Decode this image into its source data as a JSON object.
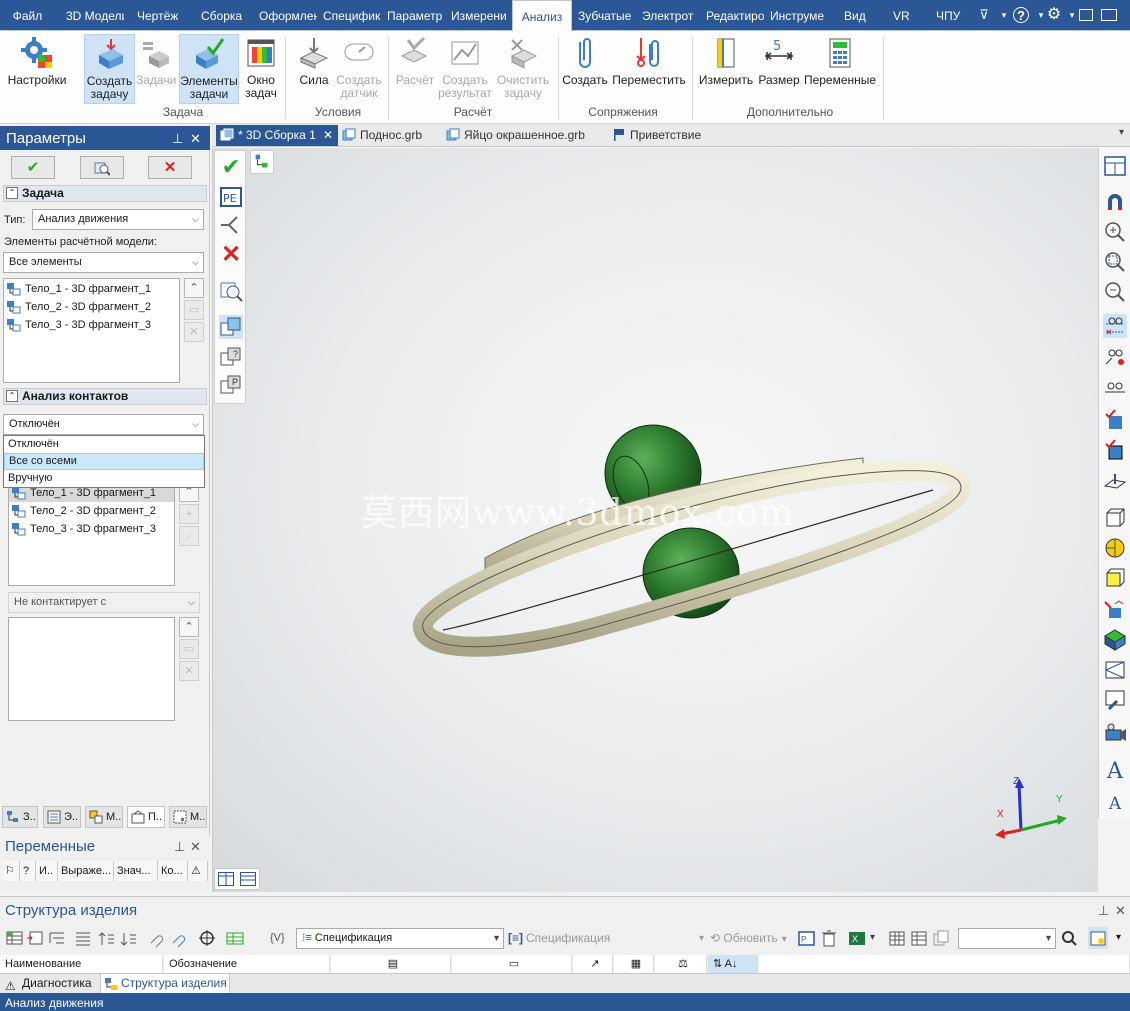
{
  "menu": {
    "tabs": [
      "Файл",
      "3D Модели",
      "Чертёж",
      "Сборка",
      "Оформлен",
      "Специфик",
      "Параметр",
      "Измерени",
      "Анализ",
      "Зубчатые",
      "Электрот",
      "Редактиро",
      "Инструме",
      "Вид",
      "VR",
      "ЧПУ"
    ],
    "active": "Анализ"
  },
  "ribbon": {
    "buttons": {
      "settings": "Настройки",
      "create_task": "Создать задачу",
      "tasks": "Задачи",
      "elements": "Элементы задачи",
      "window": "Окно задач",
      "force": "Сила",
      "create_sensor": "Создать датчик",
      "calc": "Расчёт",
      "create_result": "Создать результат",
      "clear_task": "Очистить задачу",
      "create": "Создать",
      "move": "Переместить",
      "measure": "Измерить",
      "size": "Размер",
      "variables": "Переменные"
    },
    "groups": {
      "task": "Задача",
      "conditions": "Условия",
      "calc": "Расчёт",
      "mates": "Сопряжения",
      "extra": "Дополнительно"
    }
  },
  "params": {
    "title": "Параметры",
    "task_section": "Задача",
    "type_label": "Тип:",
    "type_value": "Анализ движения",
    "elements_label": "Элементы расчётной модели:",
    "elements_value": "Все элементы",
    "bodies": [
      "Тело_1 - 3D фрагмент_1",
      "Тело_2 - 3D фрагмент_2",
      "Тело_3 - 3D фрагмент_3"
    ],
    "contacts_section": "Анализ контактов",
    "contacts_value": "Отключён",
    "contacts_options": [
      "Отключён",
      "Все со всеми",
      "Вручную"
    ],
    "contacts_highlight": "Все со всеми",
    "contact_bodies": [
      "Тело_1 - 3D фрагмент_1",
      "Тело_2 - 3D фрагмент_2",
      "Тело_3 - 3D фрагмент_3"
    ],
    "no_contact": "Не контактирует с"
  },
  "left_tabs": [
    "З..",
    "Э..",
    "М..",
    "П..",
    "М.."
  ],
  "variables": {
    "title": "Переменные",
    "cols": [
      "?",
      "И..",
      "Выраже...",
      "Знач...",
      "Ко..."
    ]
  },
  "doc_tabs": [
    "* 3D Сборка 1",
    "Поднос.grb",
    "Яйцо окрашенное.grb",
    "Приветствие"
  ],
  "watermark": "莫西网www.3dmox.com",
  "axes": {
    "x": "X",
    "y": "Y",
    "z": "Z"
  },
  "structure": {
    "title": "Структура изделия",
    "spec1": "Спецификация",
    "spec2": "Спецификация",
    "update": "Обновить",
    "cols": [
      "Наименование",
      "Обозначение"
    ]
  },
  "bottom_tabs": [
    "Диагностика",
    "Структура изделия"
  ],
  "status": "Анализ движения"
}
